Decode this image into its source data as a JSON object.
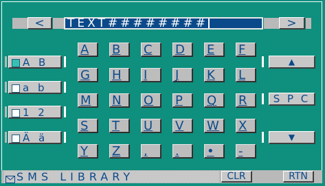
{
  "header": {
    "prev_label": "<",
    "next_label": ">",
    "field_text": "TEXT########"
  },
  "side": {
    "mode_upper": "A B",
    "mode_lower": "a b",
    "mode_numeric": "1 2",
    "mode_accent": "Ä ä"
  },
  "keys": {
    "row1": [
      "A",
      "B",
      "C",
      "D",
      "E",
      "F"
    ],
    "row2": [
      "G",
      "H",
      "I",
      "J",
      "K",
      "L"
    ],
    "row3": [
      "M",
      "N",
      "O",
      "P",
      "Q",
      "R"
    ],
    "row4": [
      "S",
      "T",
      "U",
      "V",
      "W",
      "X"
    ],
    "row5": [
      "Y",
      "Z",
      ",",
      ".",
      "•",
      "-"
    ]
  },
  "right": {
    "up_label": "▲",
    "space_label": "S P C",
    "down_label": "▼"
  },
  "status": {
    "title": "SMS LIBRARY",
    "clear_label": "CLR",
    "return_label": "RTN"
  },
  "colors": {
    "background": "#0f8f7e",
    "field": "#0b4a8a",
    "text": "#0b4a8a"
  }
}
